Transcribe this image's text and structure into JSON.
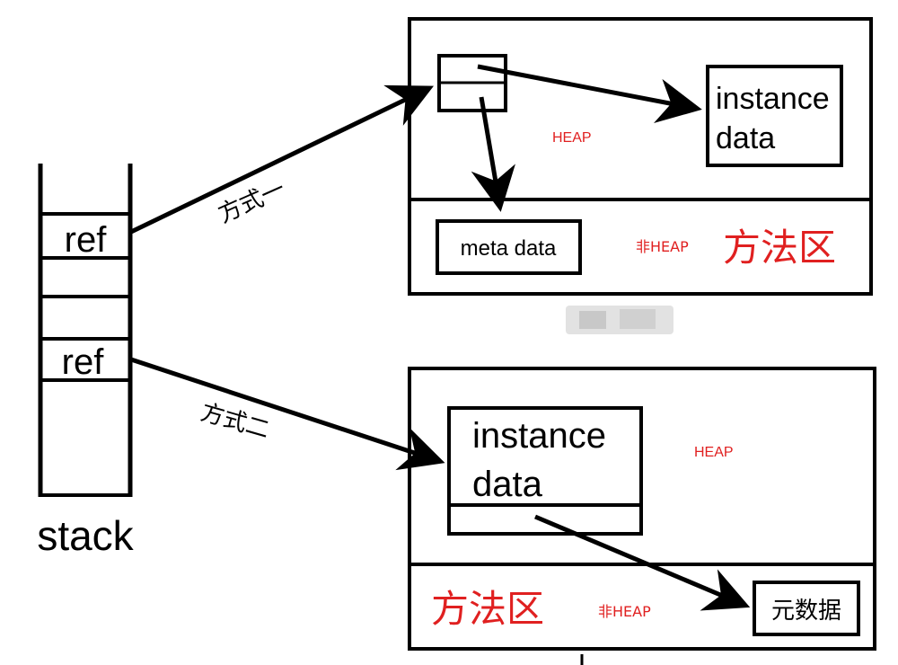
{
  "stack": {
    "label": "stack",
    "ref_top": "ref",
    "ref_bottom": "ref"
  },
  "method_one": {
    "label": "方式一",
    "instance_line1": "instance",
    "instance_line2": "data",
    "heap_label": "HEAP",
    "meta_label": "meta data",
    "non_heap_label": "非HEAP",
    "method_area_label": "方法区"
  },
  "method_two": {
    "label": "方式二",
    "instance_line1": "instance",
    "instance_line2": "data",
    "heap_label": "HEAP",
    "meta_label": "元数据",
    "non_heap_label": "非HEAP",
    "method_area_label": "方法区"
  },
  "colors": {
    "stroke": "#000000",
    "accent_red": "#e02020"
  }
}
